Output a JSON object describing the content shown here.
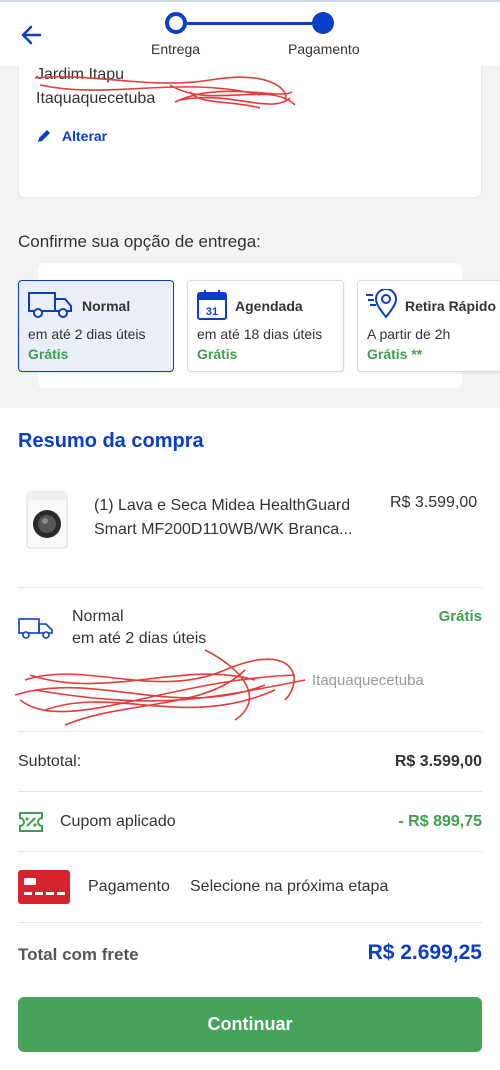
{
  "header": {
    "steps": [
      "Entrega",
      "Pagamento"
    ]
  },
  "address": {
    "line1": "Jardim Itapu",
    "line2": "Itaquaquecetuba",
    "edit_label": "Alterar"
  },
  "delivery": {
    "prompt": "Confirme sua opção de entrega:",
    "options": [
      {
        "title": "Normal",
        "sub": "em até 2 dias úteis",
        "price": "Grátis",
        "icon": "truck-icon"
      },
      {
        "title": "Agendada",
        "sub": "em até 18 dias úteis",
        "price": "Grátis",
        "icon": "calendar-icon",
        "calendar_day": "31"
      },
      {
        "title": "Retira Rápido",
        "sub": "A partir de 2h",
        "price": "Grátis **",
        "icon": "pickup-pin-icon"
      }
    ]
  },
  "summary": {
    "title": "Resumo da compra",
    "product": {
      "name": "(1) Lava e Seca Midea HealthGuard Smart MF200D110WB/WK Branca...",
      "price": "R$ 3.599,00"
    },
    "shipping": {
      "title": "Normal",
      "sub": "em até 2 dias úteis",
      "price": "Grátis",
      "city": "Itaquaquecetuba"
    },
    "subtotal_label": "Subtotal:",
    "subtotal_value": "R$ 3.599,00",
    "coupon_label": "Cupom aplicado",
    "coupon_value": "- R$ 899,75",
    "payment_label": "Pagamento",
    "payment_value": "Selecione na próxima etapa",
    "total_label": "Total com frete",
    "total_value": "R$ 2.699,25"
  },
  "cta_label": "Continuar",
  "colors": {
    "primary": "#0a3ec7",
    "success": "#45a35a",
    "card_red": "#d6232e"
  }
}
